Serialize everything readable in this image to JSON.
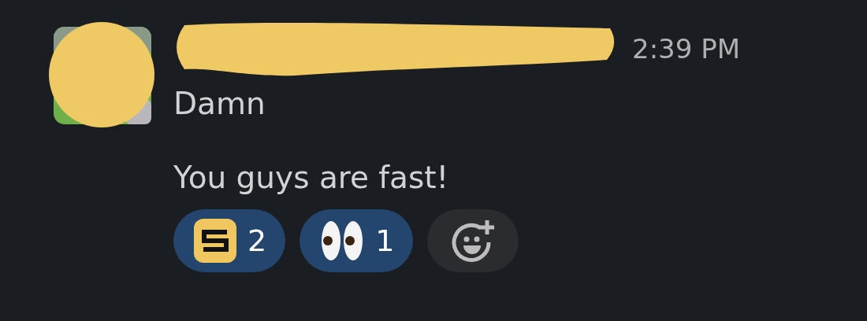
{
  "message": {
    "time": "2:39 PM",
    "lines": [
      "Damn",
      "You guys are fast!"
    ],
    "reactions": [
      {
        "kind": "s-logo",
        "count": "2",
        "selected": true
      },
      {
        "kind": "eyes",
        "count": "1",
        "selected": true
      }
    ]
  }
}
